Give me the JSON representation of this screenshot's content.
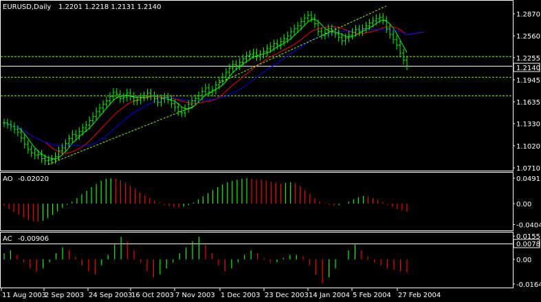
{
  "header": {
    "symbol": "EURUSD,Daily",
    "ohlc": "1.2201 1.2218 1.2131 1.2140"
  },
  "colors": {
    "background": "#000000",
    "grid_frame": "#ffffff",
    "bars": "#00ff00",
    "ma_fast": "#00ff00",
    "ma_mid": "#ff0000",
    "ma_slow": "#0000ff",
    "levels": "#80ff00",
    "ao_up": "#00ff00",
    "ao_down": "#ff0000"
  },
  "price_pane": {
    "price_labels": [
      "1.2870",
      "1.2560",
      "1.2255",
      "1.1945",
      "1.1635",
      "1.1330",
      "1.1020",
      "1.0710"
    ],
    "current_price": "1.2140"
  },
  "ao_pane": {
    "label": "AO",
    "value": "-0.02020",
    "scale_labels": [
      "0.0491",
      "0.00",
      "-0.0404"
    ]
  },
  "ac_pane": {
    "label": "AC",
    "value": "-0.00906",
    "scale_labels": [
      "0.0155",
      "0.00",
      "-0.0164"
    ],
    "marker_label": "0.0078"
  },
  "time_axis": {
    "labels": [
      "11 Aug 2003",
      "2 Sep 2003",
      "24 Sep 2003",
      "16 Oct 2003",
      "7 Nov 2003",
      "1 Dec 2003",
      "23 Dec 2003",
      "14 Jan 2004",
      "5 Feb 2004",
      "27 Feb 2004"
    ]
  },
  "chart_data": {
    "type": "bar",
    "title": "EURUSD,Daily",
    "x_labels": [
      "11 Aug 2003",
      "2 Sep 2003",
      "24 Sep 2003",
      "16 Oct 2003",
      "7 Nov 2003",
      "1 Dec 2003",
      "23 Dec 2003",
      "14 Jan 2004",
      "5 Feb 2004",
      "27 Feb 2004"
    ],
    "ylim": [
      1.071,
      1.287
    ],
    "price_close_series": [
      1.134,
      1.132,
      1.129,
      1.125,
      1.121,
      1.113,
      1.104,
      1.097,
      1.092,
      1.089,
      1.09,
      1.084,
      1.081,
      1.082,
      1.083,
      1.087,
      1.095,
      1.099,
      1.105,
      1.112,
      1.118,
      1.116,
      1.122,
      1.127,
      1.131,
      1.137,
      1.143,
      1.15,
      1.155,
      1.16,
      1.165,
      1.171,
      1.177,
      1.174,
      1.168,
      1.17,
      1.176,
      1.171,
      1.165,
      1.166,
      1.17,
      1.172,
      1.176,
      1.172,
      1.168,
      1.163,
      1.168,
      1.17,
      1.167,
      1.161,
      1.156,
      1.15,
      1.148,
      1.154,
      1.16,
      1.165,
      1.168,
      1.172,
      1.178,
      1.183,
      1.177,
      1.18,
      1.187,
      1.193,
      1.198,
      1.205,
      1.211,
      1.216,
      1.214,
      1.219,
      1.224,
      1.228,
      1.23,
      1.232,
      1.227,
      1.23,
      1.234,
      1.238,
      1.241,
      1.245,
      1.243,
      1.248,
      1.252,
      1.256,
      1.262,
      1.266,
      1.27,
      1.276,
      1.281,
      1.285,
      1.281,
      1.273,
      1.262,
      1.257,
      1.26,
      1.266,
      1.262,
      1.259,
      1.254,
      1.249,
      1.253,
      1.257,
      1.261,
      1.265,
      1.262,
      1.266,
      1.27,
      1.274,
      1.277,
      1.28,
      1.282,
      1.278,
      1.266,
      1.258,
      1.251,
      1.243,
      1.232,
      1.222,
      1.214
    ],
    "series": [
      {
        "name": "AO",
        "values": [
          -0.004,
          -0.01,
          -0.016,
          -0.022,
          -0.027,
          -0.031,
          -0.034,
          -0.035,
          -0.033,
          -0.028,
          -0.022,
          -0.015,
          -0.008,
          -0.002,
          0.004,
          0.011,
          0.018,
          0.025,
          0.032,
          0.038,
          0.044,
          0.048,
          0.049,
          0.048,
          0.045,
          0.04,
          0.034,
          0.028,
          0.022,
          0.016,
          0.011,
          0.006,
          0.002,
          -0.002,
          -0.005,
          -0.007,
          -0.008,
          -0.006,
          -0.003,
          0.002,
          0.008,
          0.014,
          0.02,
          0.026,
          0.032,
          0.037,
          0.041,
          0.044,
          0.046,
          0.048,
          0.049,
          0.048,
          0.047,
          0.046,
          0.044,
          0.042,
          0.04,
          0.038,
          0.04,
          0.041,
          0.039,
          0.034,
          0.026,
          0.018,
          0.01,
          0.004,
          0.001,
          -0.002,
          -0.004,
          -0.003,
          0.0,
          0.004,
          0.008,
          0.012,
          0.015,
          0.014,
          0.011,
          0.007,
          0.003,
          -0.002,
          -0.006,
          -0.01,
          -0.013,
          -0.016
        ]
      },
      {
        "name": "AC",
        "values": [
          0.004,
          0.006,
          0.003,
          -0.002,
          -0.006,
          -0.008,
          -0.006,
          -0.002,
          0.004,
          0.008,
          0.006,
          0.002,
          -0.004,
          -0.008,
          -0.01,
          -0.004,
          0.003,
          0.01,
          0.015,
          0.012,
          0.006,
          -0.002,
          -0.008,
          -0.012,
          -0.01,
          -0.006,
          -0.002,
          0.004,
          0.008,
          0.012,
          0.015,
          0.01,
          0.004,
          -0.004,
          -0.008,
          -0.006,
          -0.002,
          0.003,
          0.006,
          0.004,
          0.001,
          -0.002,
          -0.002,
          0.001,
          0.003,
          0.003,
          0.002,
          -0.004,
          -0.01,
          -0.016,
          -0.012,
          -0.006,
          0.0,
          0.006,
          0.01,
          0.006,
          0.002,
          -0.002,
          -0.004,
          -0.006,
          -0.007,
          -0.008,
          -0.009
        ]
      }
    ]
  }
}
